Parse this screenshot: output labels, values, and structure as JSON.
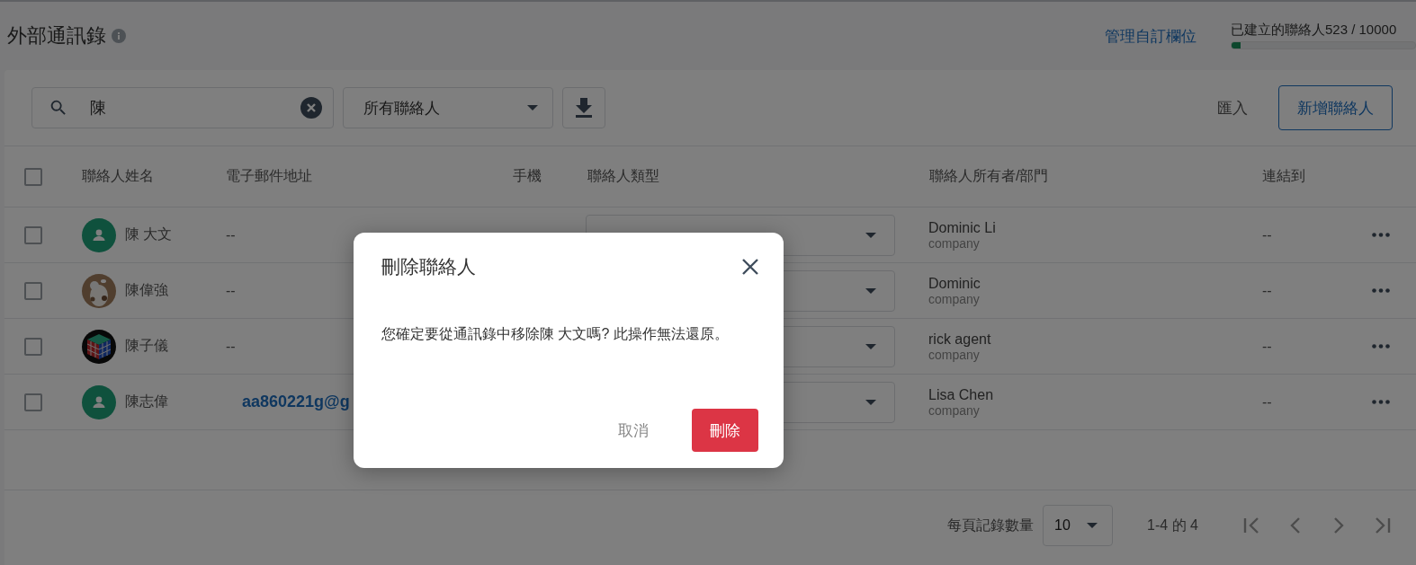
{
  "header": {
    "title": "外部通訊錄",
    "manage_link": "管理自訂欄位",
    "quota": {
      "label": "已建立的聯絡人523 / 10000",
      "level": 0.05
    }
  },
  "toolbar": {
    "search": {
      "value": "陳"
    },
    "filter": {
      "value": "所有聯絡人"
    },
    "import": "匯入",
    "add": "新增聯絡人"
  },
  "table": {
    "select_all_checked": false,
    "columns": [
      "聯絡人姓名",
      "電子郵件地址",
      "手機",
      "聯絡人類型",
      "聯絡人所有者/部門",
      "連結到"
    ],
    "rows": [
      {
        "name": "陳 大文",
        "avatar": {
          "kind": "default"
        },
        "email": "--",
        "email_link": false,
        "owner": "Dominic Li",
        "department": "company",
        "linked": "--",
        "checked": false
      },
      {
        "name": "陳偉強",
        "email": "--",
        "email_link": false,
        "owner": "Dominic",
        "department": "company",
        "linked": "--",
        "checked": false
      },
      {
        "name": "陳子儀",
        "email": "--",
        "email_link": false,
        "owner": "rick agent",
        "department": "company",
        "linked": "--",
        "checked": false
      },
      {
        "name": "陳志偉",
        "avatar": {
          "kind": "default"
        },
        "email": "aa860221g@g",
        "email_link": true,
        "owner": "Lisa Chen",
        "department": "company",
        "linked": "--",
        "checked": false
      }
    ]
  },
  "pagination": {
    "per_page_label": "每頁記錄數量",
    "per_page": "10",
    "range": "1-4 的 4"
  },
  "dialog": {
    "title": "刪除聯絡人",
    "message": "您確定要從通訊錄中移除陳 大文嗎? 此操作無法還原。",
    "cancel": "取消",
    "confirm": "刪除"
  }
}
